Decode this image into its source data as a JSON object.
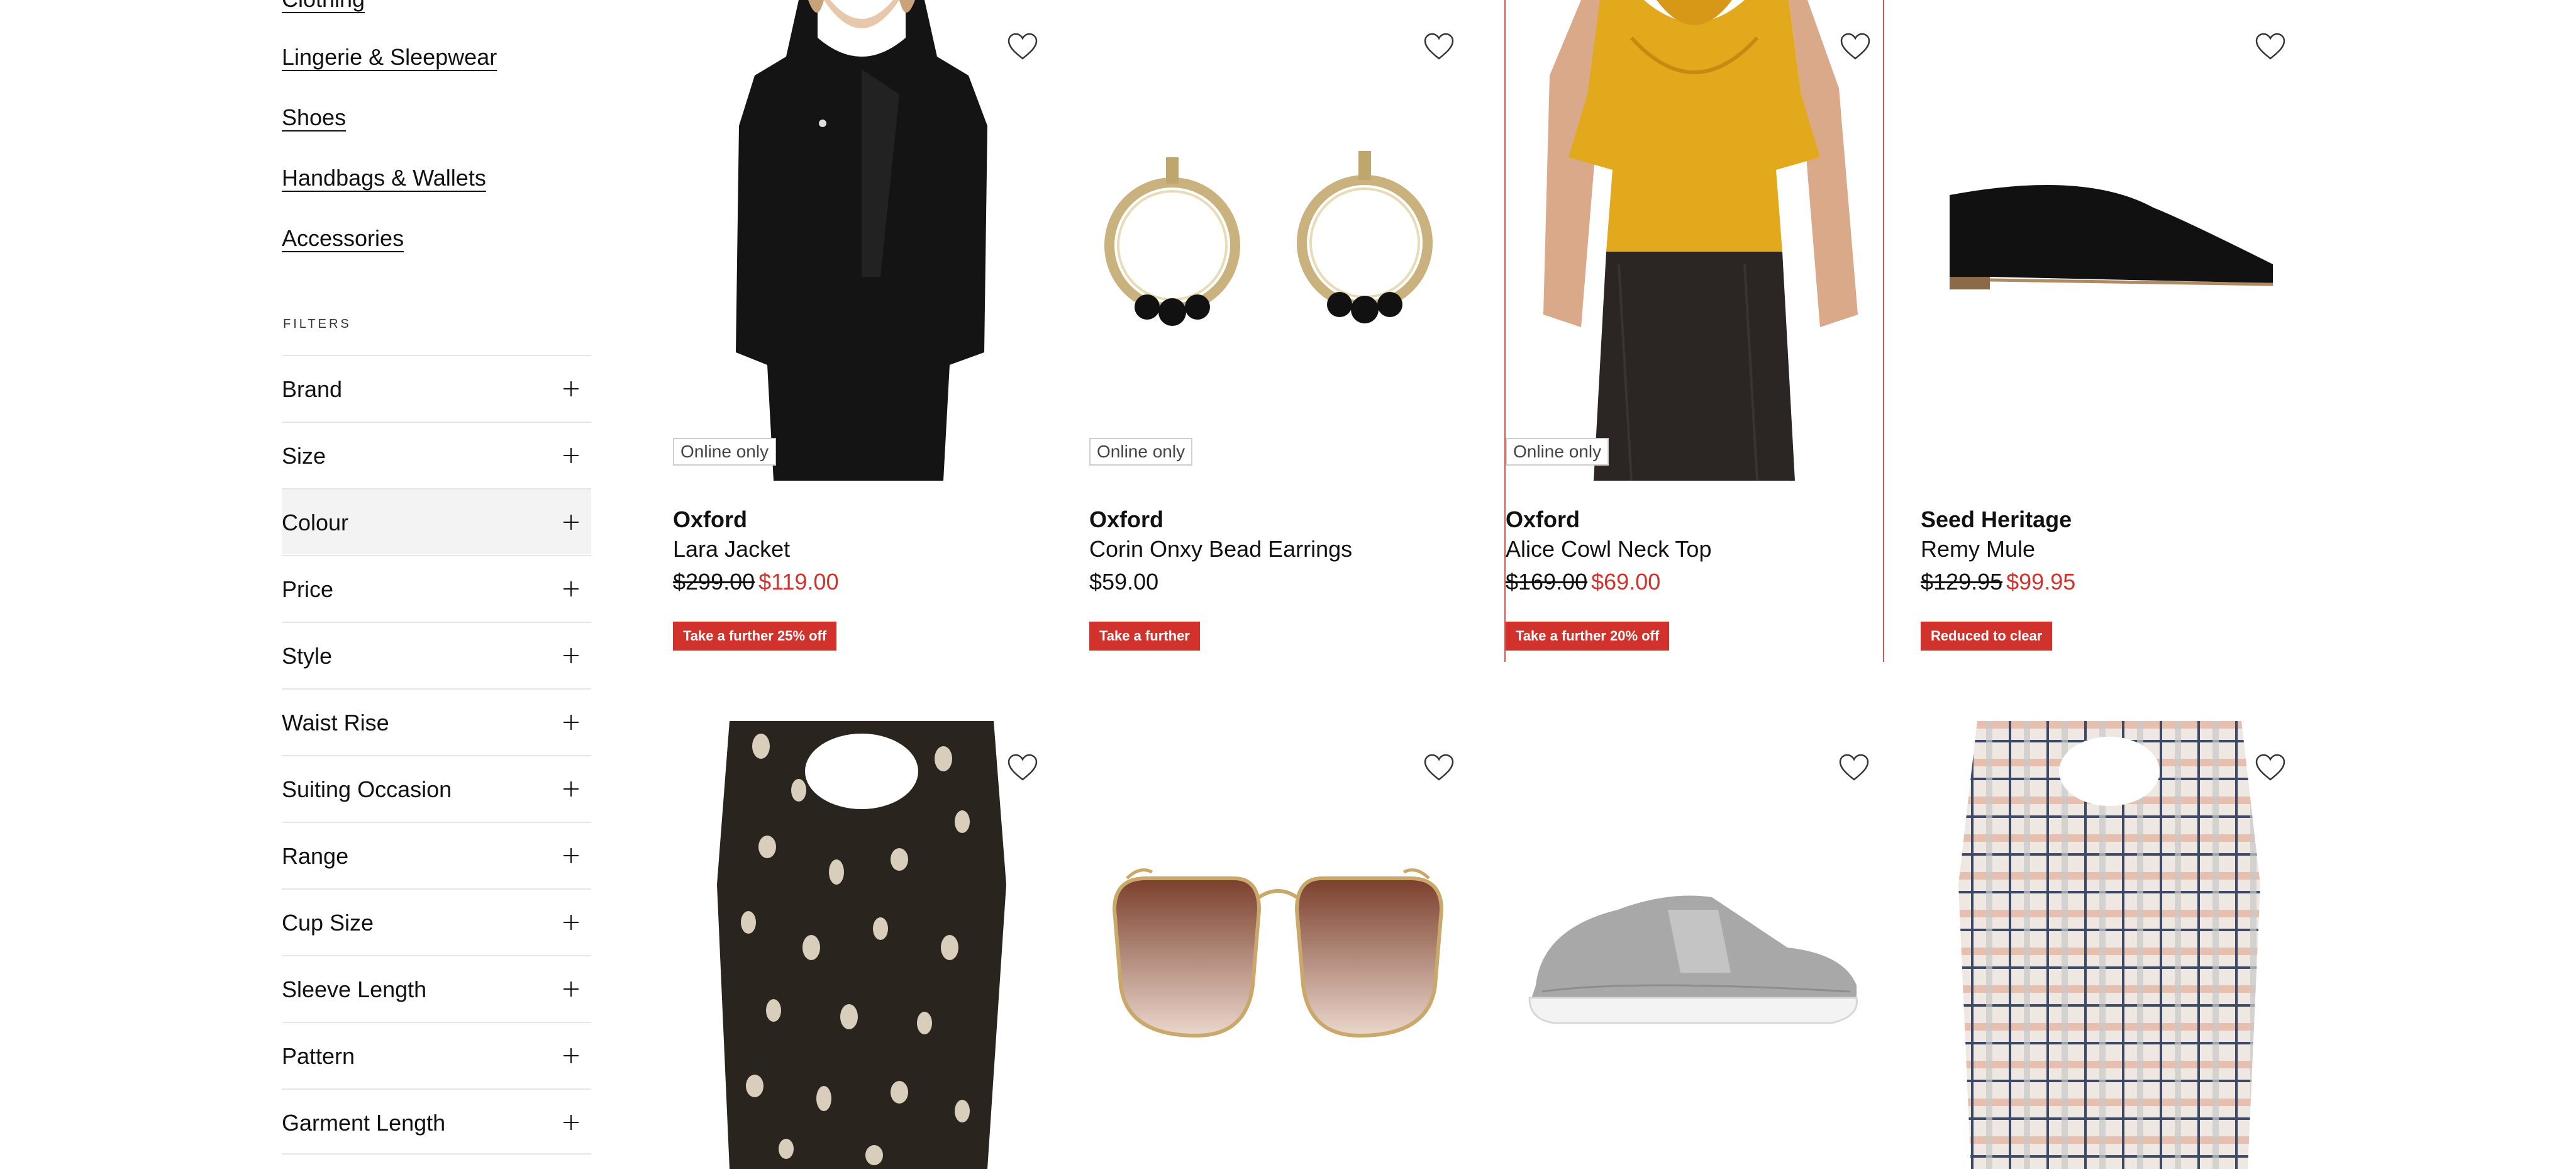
{
  "sidebar": {
    "categories": [
      "Clothing",
      "Lingerie & Sleepwear",
      "Shoes",
      "Handbags & Wallets",
      "Accessories"
    ],
    "filters_heading": "FILTERS",
    "filters": [
      "Brand",
      "Size",
      "Colour",
      "Price",
      "Style",
      "Waist Rise",
      "Suiting Occasion",
      "Range",
      "Cup Size",
      "Sleeve Length",
      "Pattern",
      "Garment Length"
    ]
  },
  "products": [
    {
      "badge": "Online only",
      "brand": "Oxford",
      "name": "Lara Jacket",
      "price_was": "$299.00",
      "price_now": "$119.00",
      "promo": "Take a further 25% off"
    },
    {
      "badge": "Online only",
      "brand": "Oxford",
      "name": "Corin Onxy Bead Earrings",
      "price": "$59.00",
      "promo": "Take a further"
    },
    {
      "badge": "Online only",
      "brand": "Oxford",
      "name": "Alice Cowl Neck Top",
      "price_was": "$169.00",
      "price_now": "$69.00",
      "promo": "Take a further 20% off"
    },
    {
      "brand": "Seed Heritage",
      "name": "Remy Mule",
      "price_was": "$129.95",
      "price_now": "$99.95",
      "promo": "Reduced to clear"
    }
  ],
  "colors": {
    "accent_red": "#d1322b",
    "focus_outline": "#d9534f"
  },
  "icons": {
    "wishlist": "heart-icon",
    "expand": "plus-icon"
  }
}
